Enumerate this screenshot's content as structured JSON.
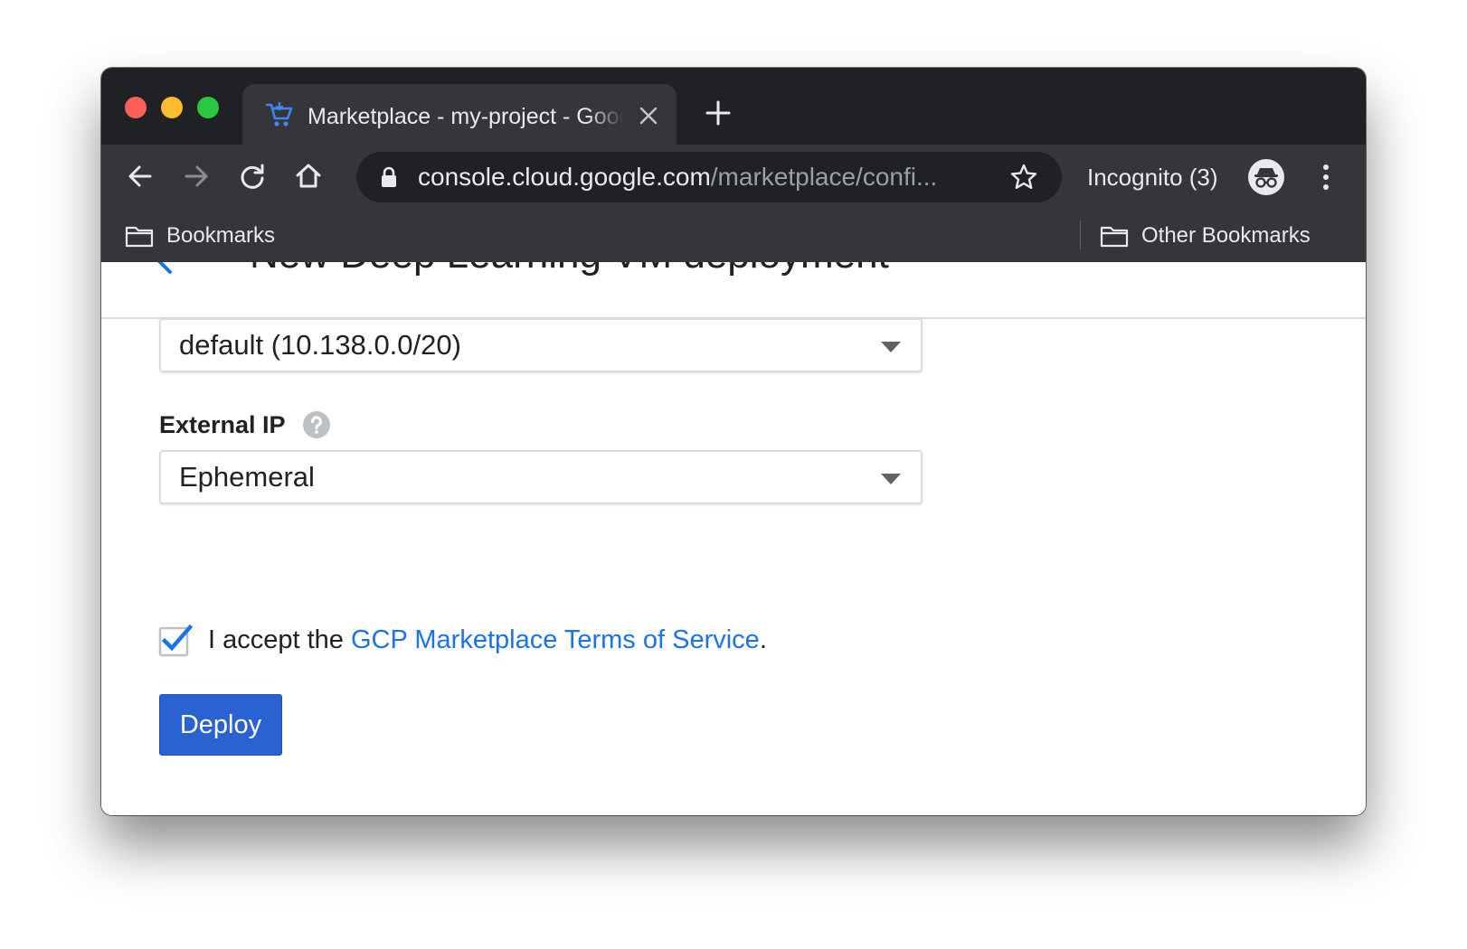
{
  "window": {
    "controls": [
      "close",
      "minimize",
      "maximize"
    ]
  },
  "tab": {
    "title": "Marketplace - my-project - Google Cloud Platform",
    "icon": "cart-icon"
  },
  "toolbar": {
    "url_host": "console.cloud.google.com",
    "url_path": "/marketplace/confi...",
    "incognito_label": "Incognito (3)"
  },
  "bookmarks": {
    "left_label": "Bookmarks",
    "right_label": "Other Bookmarks"
  },
  "page": {
    "title": "New Deep Learning VM deployment",
    "subnetwork_value": "default (10.138.0.0/20)",
    "external_ip_label": "External IP",
    "external_ip_value": "Ephemeral",
    "terms_prefix": "I accept the ",
    "terms_link": "GCP Marketplace Terms of Service",
    "terms_suffix": ".",
    "terms_checked": true,
    "deploy_label": "Deploy"
  },
  "colors": {
    "accent": "#1a73e8",
    "deploy_button": "#2a62d4",
    "chrome_dark": "#202124",
    "chrome_toolbar": "#35363a"
  }
}
